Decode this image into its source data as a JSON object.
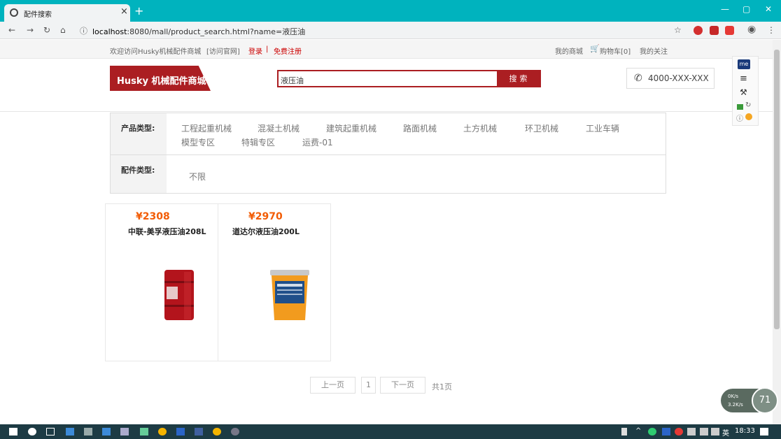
{
  "browser": {
    "tab_title": "配件搜索",
    "tab_close": "×",
    "new_tab": "+",
    "url_host": "localhost",
    "url_rest": ":8080/mall/product_search.html?name=液压油"
  },
  "topbar": {
    "welcome": "欢迎访问Husky机械配件商城",
    "visit_site": "[访问官网]",
    "login": "登录",
    "sep": "|",
    "register": "免费注册",
    "my_mall": "我的商城",
    "cart": "购物车[0]",
    "my_follow": "我的关注"
  },
  "header": {
    "logo": "Husky 机械配件商城",
    "search_value": "液压油",
    "search_btn": "搜索",
    "phone": "4000-XXX-XXX"
  },
  "filter": {
    "product_type_label": "产品类型:",
    "product_types": [
      "工程起重机械",
      "混凝土机械",
      "建筑起重机械",
      "路面机械",
      "土方机械",
      "环卫机械",
      "工业车辆",
      "模型专区",
      "特辑专区",
      "运费-01"
    ],
    "part_type_label": "配件类型:",
    "part_type_value": "不限"
  },
  "products": [
    {
      "price": "¥2308",
      "name": "中联-美孚液压油208L"
    },
    {
      "price": "¥2970",
      "name": "道达尔液压油200L"
    }
  ],
  "pager": {
    "prev": "上一页",
    "page": "1",
    "next": "下一页",
    "total": "共1页"
  },
  "speed": {
    "down": "0K/s",
    "up": "3.2K/s",
    "percent": "71"
  },
  "taskbar": {
    "ime": "英",
    "time": "18:33"
  },
  "colors": {
    "tab_bar": "#00b3be",
    "brand_red": "#ab1e22",
    "price_orange": "#f25c05",
    "taskbar": "#1d3b44"
  }
}
